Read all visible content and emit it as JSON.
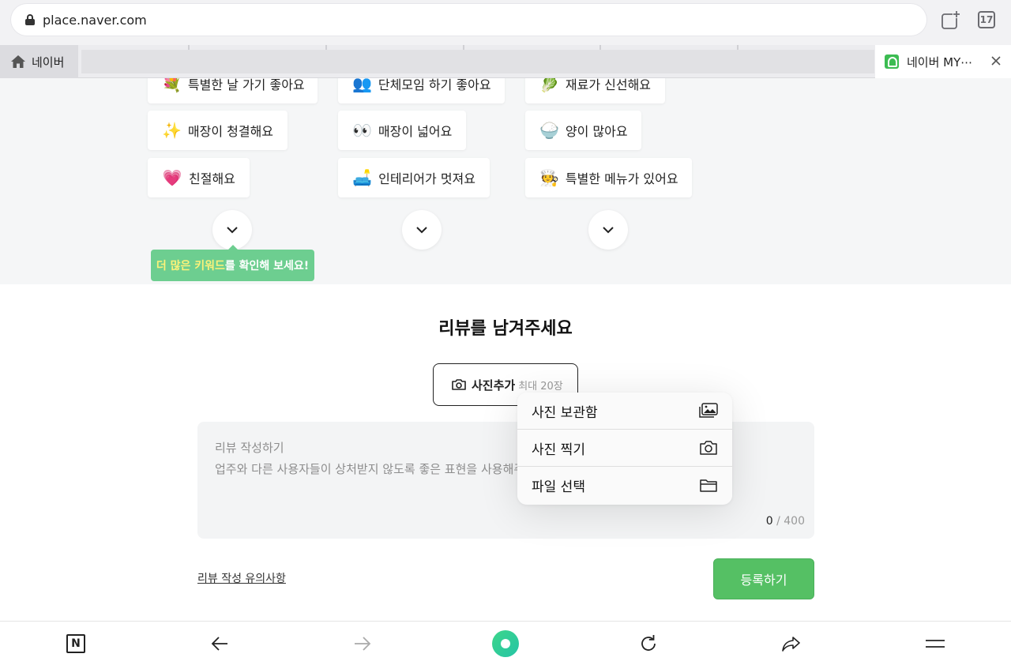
{
  "browser": {
    "url": "place.naver.com",
    "tab_count": "17",
    "home_tab_label": "네이버",
    "active_tab_title": "네이버 MY⋯"
  },
  "keywords": {
    "columns": [
      [
        {
          "emoji": "💐",
          "label": "특별한 날 가기 좋아요"
        },
        {
          "emoji": "✨",
          "label": "매장이 청결해요"
        },
        {
          "emoji": "💗",
          "label": "친절해요"
        }
      ],
      [
        {
          "emoji": "👥",
          "label": "단체모임 하기 좋아요"
        },
        {
          "emoji": "👀",
          "label": "매장이 넓어요"
        },
        {
          "emoji": "🛋️",
          "label": "인테리어가 멋져요"
        }
      ],
      [
        {
          "emoji": "🥬",
          "label": "재료가 신선해요"
        },
        {
          "emoji": "🍚",
          "label": "양이 많아요"
        },
        {
          "emoji": "🧑‍🍳",
          "label": "특별한 메뉴가 있어요"
        }
      ]
    ],
    "tooltip_highlight": "더 많은 키워드",
    "tooltip_rest": "를 확인해 보세요!"
  },
  "review": {
    "title": "리뷰를 남겨주세요",
    "photo_button_label": "사진추가",
    "photo_button_limit": "최대 20장",
    "placeholder_title": "리뷰 작성하기",
    "placeholder_body": "업주와 다른 사용자들이 상처받지 않도록 좋은 표현을 사용해주",
    "char_count": "0",
    "char_max": "/ 400",
    "notice_link": "리뷰 작성 유의사항",
    "submit_label": "등록하기"
  },
  "photo_menu": {
    "items": [
      {
        "label": "사진 보관함",
        "icon": "photo-library-icon"
      },
      {
        "label": "사진 찍기",
        "icon": "camera-icon"
      },
      {
        "label": "파일 선택",
        "icon": "folder-icon"
      }
    ]
  },
  "toolbar": {
    "n_logo": "N"
  },
  "colors": {
    "accent_green": "#55c064",
    "tooltip_green": "#6dce90",
    "tooltip_highlight": "#fbf27a"
  }
}
